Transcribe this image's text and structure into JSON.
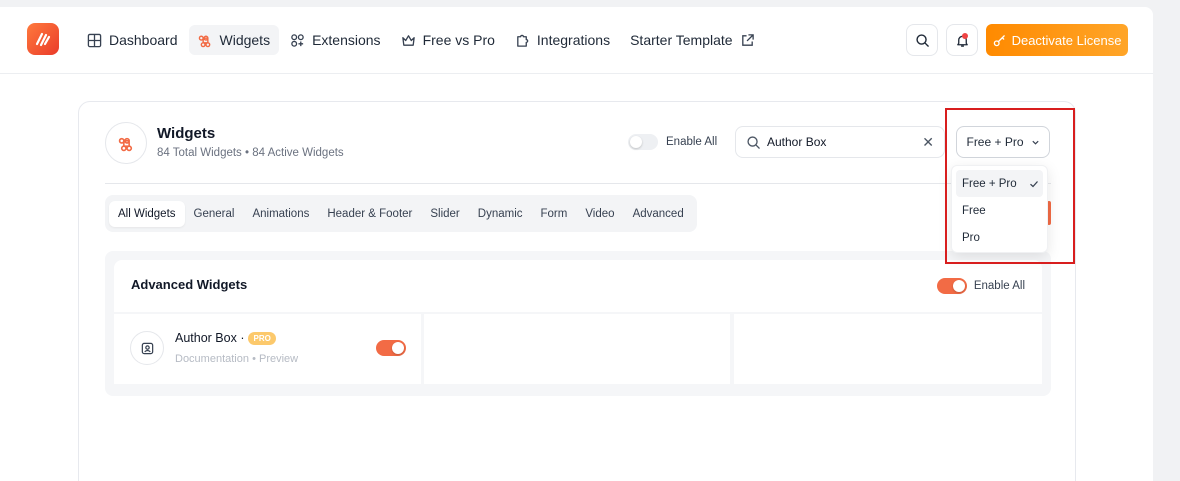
{
  "nav": {
    "items": [
      {
        "label": "Dashboard",
        "icon": "grid-icon"
      },
      {
        "label": "Widgets",
        "icon": "command-icon",
        "active": true
      },
      {
        "label": "Extensions",
        "icon": "extensions-icon"
      },
      {
        "label": "Free vs Pro",
        "icon": "crown-icon"
      },
      {
        "label": "Integrations",
        "icon": "puzzle-icon"
      },
      {
        "label": "Starter Template",
        "icon": "external-link-icon"
      }
    ],
    "deactivate_label": "Deactivate License"
  },
  "widgets": {
    "title": "Widgets",
    "total": "84 Total Widgets",
    "separator": "•",
    "active": "84 Active Widgets",
    "enable_all_label": "Enable All",
    "search_value": "Author Box",
    "filter_value": "Free + Pro"
  },
  "tabs": [
    "All Widgets",
    "General",
    "Animations",
    "Header & Footer",
    "Slider",
    "Dynamic",
    "Form",
    "Video",
    "Advanced"
  ],
  "panel": {
    "title": "Advanced Widgets",
    "enable_all_label": "Enable All",
    "widget": {
      "name": "Author Box ·",
      "badge": "PRO",
      "link_doc": "Documentation",
      "link_sep": "•",
      "link_preview": "Preview",
      "enabled": true
    }
  },
  "dropdown": {
    "options": [
      "Free + Pro",
      "Free",
      "Pro"
    ],
    "selected": "Free + Pro"
  },
  "colors": {
    "accent": "#f26b45",
    "cta": "#ff8a00",
    "highlight": "#d81e1e"
  }
}
